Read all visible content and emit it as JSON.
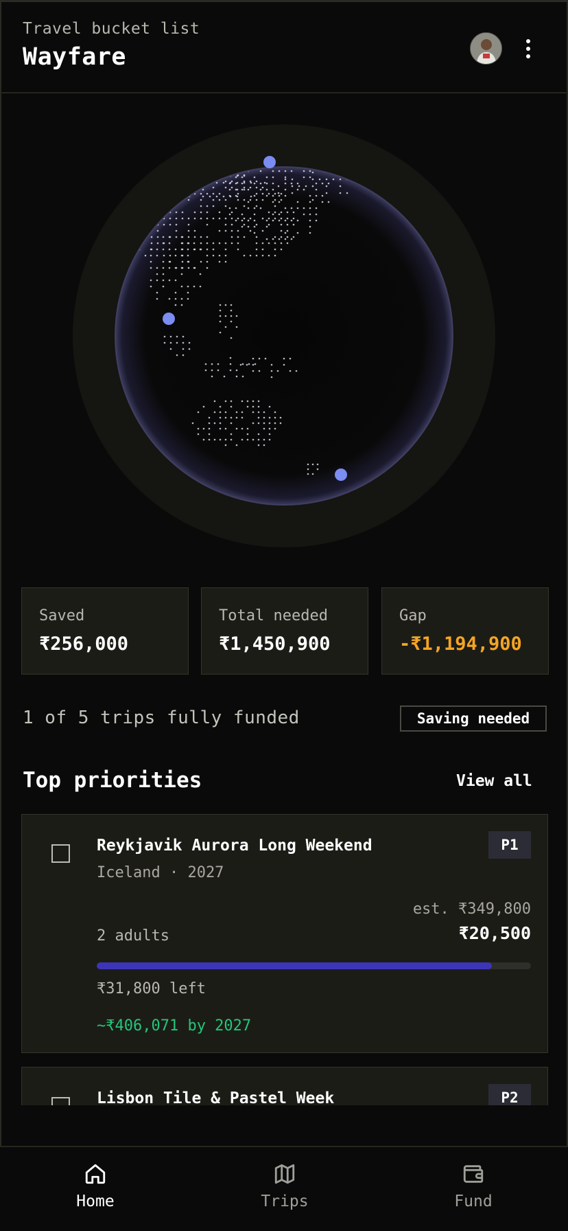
{
  "header": {
    "subtitle": "Travel bucket list",
    "title": "Wayfare"
  },
  "globe": {
    "markers": 3,
    "marker_color": "#7b8cf2",
    "ring_color": "#161612"
  },
  "stats": {
    "saved": {
      "label": "Saved",
      "value": "₹256,000"
    },
    "total": {
      "label": "Total needed",
      "value": "₹1,450,900"
    },
    "gap": {
      "label": "Gap",
      "value": "-₹1,194,900",
      "color": "#f5a524"
    }
  },
  "summary": {
    "funded_text": "1 of 5 trips fully funded",
    "status_badge": "Saving needed"
  },
  "priorities": {
    "title": "Top priorities",
    "view_all": "View all",
    "trips": [
      {
        "name": "Reykjavik Aurora Long Weekend",
        "meta": "Iceland · 2027",
        "priority": "P1",
        "estimate": "est. ₹349,800",
        "amount": "₹20,500",
        "travelers": "2 adults",
        "progress": 0.91,
        "remaining": "₹31,800 left",
        "projection": "~₹406,071 by 2027",
        "bar_color": "#3d35b8",
        "projection_color": "#22c77a"
      },
      {
        "name": "Lisbon Tile & Pastel Week",
        "priority": "P2"
      }
    ]
  },
  "nav": {
    "items": [
      {
        "label": "Home",
        "icon": "home-icon",
        "active": true
      },
      {
        "label": "Trips",
        "icon": "map-icon",
        "active": false
      },
      {
        "label": "Fund",
        "icon": "wallet-icon",
        "active": false
      }
    ]
  }
}
